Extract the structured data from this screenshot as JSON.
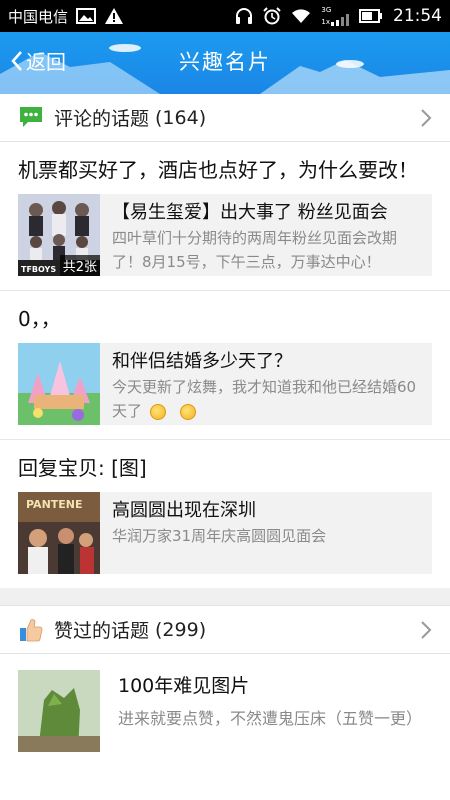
{
  "status_bar": {
    "carrier": "中国电信",
    "time": "21:54",
    "network": "3G",
    "network_sub": "1x"
  },
  "header": {
    "back_label": "返回",
    "title": "兴趣名片"
  },
  "comments_section": {
    "label": "评论的话题",
    "count": "(164)",
    "icon": "chat-bubble-icon",
    "accent": "#3fb13f"
  },
  "topics": [
    {
      "text": "机票都买好了，酒店也点好了，为什么要改！",
      "card_title": "【易生玺爱】出大事了 粉丝见面会",
      "card_desc": "四叶草们十分期待的两周年粉丝见面会改期了！8月15号，下午三点，万事达中心！",
      "thumb_badge": "共2张",
      "thumb_caption": "TFBOYS"
    },
    {
      "text": "0，，",
      "card_title": "和伴侣结婚多少天了？",
      "card_desc": "今天更新了炫舞，我才知道我和他已经结婚60天了"
    },
    {
      "text": "回复宝贝: [图]",
      "card_title": "高圆圆出现在深圳",
      "card_desc": "华润万家31周年庆高圆圆见面会",
      "thumb_caption": "PANTENE"
    }
  ],
  "liked_section": {
    "label": "赞过的话题",
    "count": "(299)",
    "icon": "thumbs-up-icon"
  },
  "liked_items": [
    {
      "title": "100年难见图片",
      "desc": "进来就要点赞，不然遭鬼压床（五赞一更）"
    }
  ]
}
